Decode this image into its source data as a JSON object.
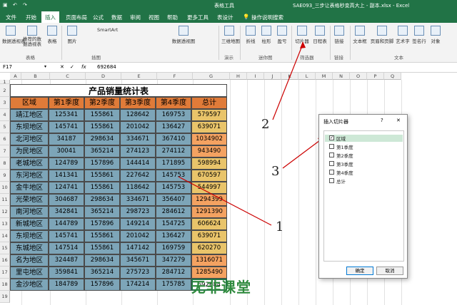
{
  "titlebar": {
    "context_tab": "表格工具",
    "filename": "SAE093_三步让表格秒变高大上 - 副本.xlsx  -  Excel"
  },
  "tabs": [
    "文件",
    "开始",
    "插入",
    "页面布局",
    "公式",
    "数据",
    "审阅",
    "视图",
    "帮助",
    "更多工具",
    "表设计",
    "操作说明搜索"
  ],
  "ribbon": {
    "buttons": [
      "数据透视表",
      "推荐的数据透视表",
      "表格",
      "图片",
      "SmartArt",
      "数据透视图",
      "三维地图",
      "折线",
      "柱形",
      "盈亏",
      "切片器",
      "日程表",
      "链接",
      "文本框",
      "页眉和页脚",
      "艺术字",
      "签名行",
      "对象"
    ],
    "groups": [
      "表格",
      "插图",
      "演示",
      "迷你图",
      "筛选器",
      "链接",
      "文本"
    ]
  },
  "formula_bar": {
    "name_box": "F17",
    "value": "692684",
    "fx": "fx"
  },
  "columns": [
    "A",
    "B",
    "C",
    "D",
    "E",
    "F",
    "G",
    "H",
    "I",
    "J",
    "K",
    "L",
    "M",
    "N",
    "O",
    "P",
    "Q"
  ],
  "table": {
    "title": "产品销量统计表",
    "headers": [
      "区域",
      "第1季度",
      "第2季度",
      "第3季度",
      "第4季度",
      "总计"
    ],
    "rows": [
      [
        "靖江地区",
        "125341",
        "155861",
        "128642",
        "169753",
        "579597"
      ],
      [
        "东坝地区",
        "145741",
        "155861",
        "201042",
        "136427",
        "639071"
      ],
      [
        "北河地区",
        "34187",
        "298634",
        "334671",
        "367410",
        "1034902"
      ],
      [
        "为民地区",
        "30041",
        "365214",
        "274123",
        "274112",
        "943490"
      ],
      [
        "老城地区",
        "124789",
        "157896",
        "144414",
        "171895",
        "598994"
      ],
      [
        "东河地区",
        "141341",
        "155861",
        "227642",
        "145753",
        "670597"
      ],
      [
        "金牛地区",
        "124741",
        "155861",
        "118642",
        "145753",
        "544997"
      ],
      [
        "光荣地区",
        "304687",
        "298634",
        "334671",
        "356407",
        "1294399"
      ],
      [
        "南河地区",
        "342841",
        "365214",
        "298723",
        "284612",
        "1291390"
      ],
      [
        "新城地区",
        "144789",
        "157896",
        "149214",
        "154725",
        "606624"
      ],
      [
        "东坝地区",
        "145741",
        "155861",
        "201042",
        "136427",
        "639071"
      ],
      [
        "东城地区",
        "147514",
        "155861",
        "147142",
        "169759",
        "620270"
      ],
      [
        "名为地区",
        "324487",
        "298634",
        "345671",
        "347279",
        "1316071"
      ],
      [
        "里屯地区",
        "359841",
        "365214",
        "275723",
        "284712",
        "1285490"
      ],
      [
        "金沙地区",
        "184789",
        "157896",
        "174214",
        "175785",
        "692684"
      ]
    ]
  },
  "dialog": {
    "title": "插入切片器",
    "help": "?",
    "close": "✕",
    "options": [
      {
        "label": "区域",
        "checked": true
      },
      {
        "label": "第1季度",
        "checked": false
      },
      {
        "label": "第2季度",
        "checked": false
      },
      {
        "label": "第3季度",
        "checked": false
      },
      {
        "label": "第4季度",
        "checked": false
      },
      {
        "label": "总计",
        "checked": false
      }
    ],
    "ok": "确定",
    "cancel": "取消"
  },
  "annotations": [
    "1",
    "2",
    "3"
  ],
  "watermark": "无非课堂",
  "colors": {
    "excel_green": "#217346",
    "header_orange": "#e07b39",
    "body_blue": "#7da5b8",
    "total_col": "#e9c46a",
    "total_max": "#f4a261",
    "watermark": "#2f8a3e"
  }
}
